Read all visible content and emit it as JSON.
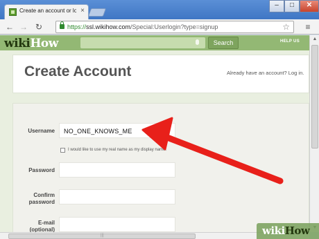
{
  "browser": {
    "tab_title": "Create an account or log in",
    "tab_close": "×",
    "window_buttons": {
      "minimize": "–",
      "maximize": "□",
      "close": "✕"
    },
    "nav": {
      "back": "←",
      "forward": "→",
      "reload": "↻"
    },
    "url": {
      "scheme": "https://",
      "host": "ssl.wikihow.com",
      "path": "/Special:Userlogin?type=signup"
    },
    "star": "☆",
    "menu": "≡"
  },
  "site": {
    "logo_wiki": "wiki",
    "logo_how": "How",
    "search_button": "Search",
    "help_us": "HELP US",
    "brand_color": "#93b874"
  },
  "page": {
    "title": "Create Account",
    "login_prompt": "Already have an account? Log in."
  },
  "form": {
    "username_label": "Username",
    "username_value": "NO_ONE_KNOWS_ME",
    "realname_checkbox_label": "I would like to use my real name as my display name.",
    "password_label": "Password",
    "confirm_label_line1": "Confirm",
    "confirm_label_line2": "password",
    "email_label_line1": "E-mail",
    "email_label_line2": "(optional)"
  },
  "annotation": {
    "arrow_color": "#e8201a"
  },
  "watermark": {
    "wiki": "wiki",
    "how": "How"
  },
  "scrollbar": {
    "grip": "|||"
  }
}
